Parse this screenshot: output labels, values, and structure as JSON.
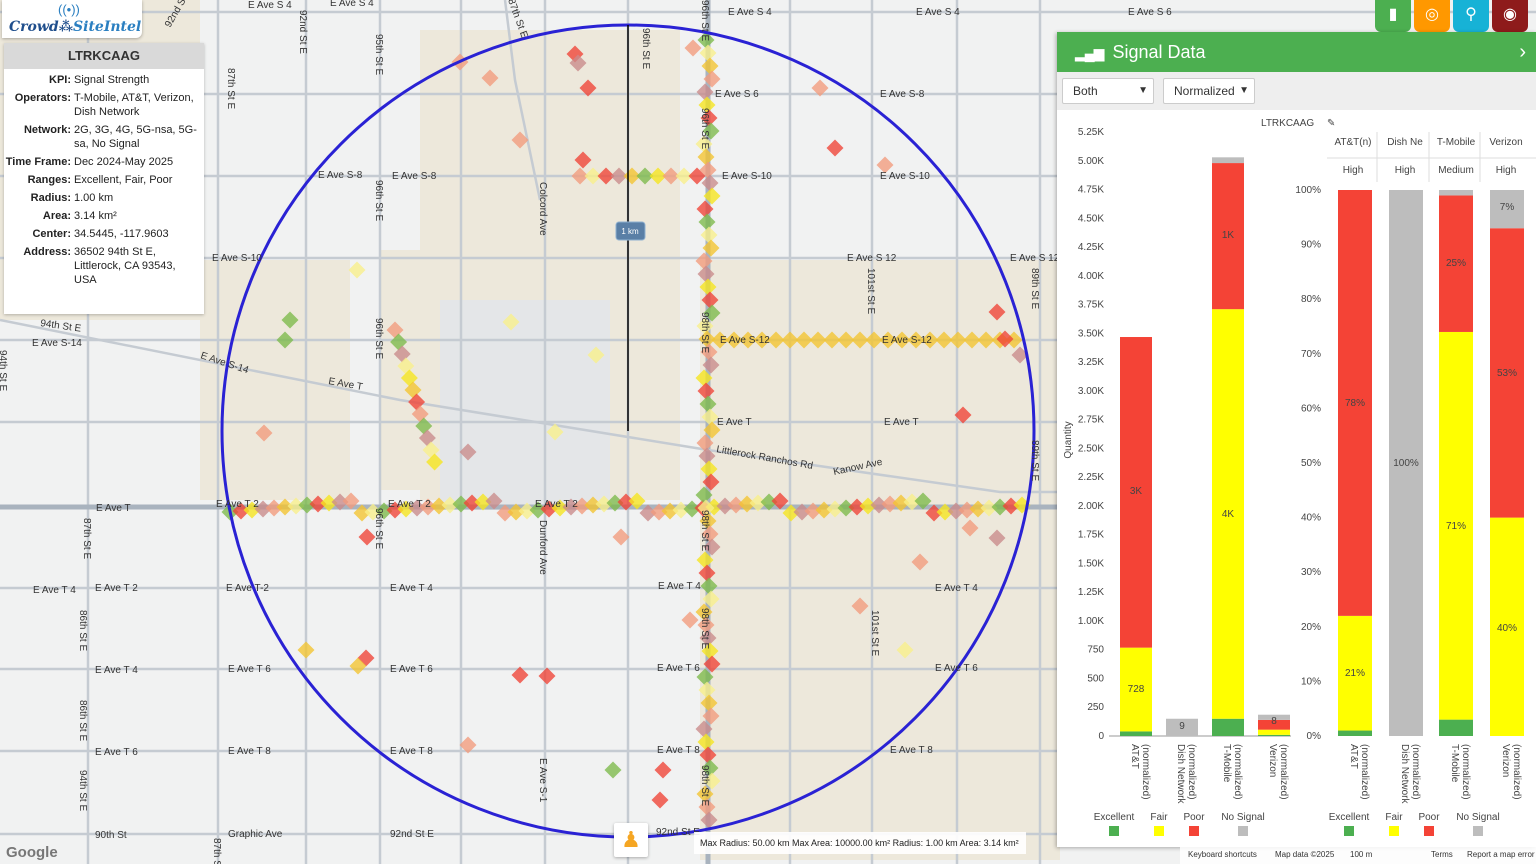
{
  "logo": {
    "text_a": "Crowd",
    "text_b": "SiteIntel",
    "icon": "signal-tower-icon"
  },
  "info": {
    "title": "LTRKCAAG",
    "rows": [
      {
        "k": "KPI:",
        "v": "Signal Strength"
      },
      {
        "k": "Operators:",
        "v": "T-Mobile, AT&T, Verizon, Dish Network"
      },
      {
        "k": "Network:",
        "v": "2G, 3G, 4G, 5G-nsa, 5G-sa, No Signal"
      },
      {
        "k": "Time Frame:",
        "v": "Dec 2024-May 2025"
      },
      {
        "k": "Ranges:",
        "v": "Excellent, Fair, Poor"
      },
      {
        "k": "Radius:",
        "v": "1.00 km"
      },
      {
        "k": "Area:",
        "v": "3.14 km²"
      },
      {
        "k": "Center:",
        "v": "34.5445, -117.9603"
      },
      {
        "k": "Address:",
        "v": "36502 94th St E, Littlerock, CA 93543, USA"
      }
    ]
  },
  "toolbar": {
    "buttons": [
      {
        "name": "chart-button",
        "icon": "bar-chart-icon",
        "glyph": "▮",
        "color": "#4caf50"
      },
      {
        "name": "target-button",
        "icon": "target-icon",
        "glyph": "◎",
        "color": "#ff9800"
      },
      {
        "name": "location-button",
        "icon": "location-pin-icon",
        "glyph": "⚲",
        "color": "#17b2d6"
      },
      {
        "name": "globe-button",
        "icon": "globe-icon",
        "glyph": "◉",
        "color": "#8e1b1b"
      }
    ]
  },
  "panel": {
    "title": "Signal Data",
    "select_operator": "Both",
    "select_mode": "Normalized",
    "chart_title": "LTRKCAAG",
    "tier_headers": [
      "AT&T(n)",
      "Dish Ne",
      "T-Mobile",
      "Verizon"
    ],
    "tier_values": [
      "High",
      "High",
      "Medium",
      "High"
    ],
    "tier_colors": [
      "#4caf50",
      "#4caf50",
      "#ff9800",
      "#4caf50"
    ]
  },
  "chart_data": [
    {
      "type": "bar",
      "stacked": true,
      "title": "LTRKCAAG",
      "ylabel": "Quantity",
      "ylim": [
        0,
        5250
      ],
      "yticks": [
        "0",
        "250",
        "500",
        "750",
        "1.00K",
        "1.25K",
        "1.50K",
        "1.75K",
        "2.00K",
        "2.25K",
        "2.50K",
        "2.75K",
        "3.00K",
        "3.25K",
        "3.50K",
        "3.75K",
        "4.00K",
        "4.25K",
        "4.50K",
        "4.75K",
        "5.00K",
        "5.25K"
      ],
      "categories": [
        "AT&T\n(normalized)",
        "Dish Network\n(normalized)",
        "T-Mobile\n(normalized)",
        "Verizon\n(normalized)"
      ],
      "series": [
        {
          "name": "Excellent",
          "color": "#4caf50",
          "values": [
            40,
            0,
            150,
            10
          ]
        },
        {
          "name": "Fair",
          "color": "#ffff00",
          "values": [
            728,
            0,
            3560,
            45
          ]
        },
        {
          "name": "Poor",
          "color": "#f44336",
          "values": [
            2700,
            0,
            1270,
            85
          ]
        },
        {
          "name": "No Signal",
          "color": "#bdbdbd",
          "values": [
            0,
            150,
            50,
            45
          ]
        }
      ],
      "data_labels": [
        "728",
        "3K",
        "9",
        "4K",
        "1K",
        "8"
      ],
      "legend": [
        "Excellent",
        "Fair",
        "Poor",
        "No Signal"
      ]
    },
    {
      "type": "bar",
      "stacked": true,
      "ylim": [
        0,
        100
      ],
      "yticks": [
        "0%",
        "10%",
        "20%",
        "30%",
        "40%",
        "50%",
        "60%",
        "70%",
        "80%",
        "90%",
        "100%"
      ],
      "categories": [
        "AT&T\n(normalized)",
        "Dish Network\n(normalized)",
        "T-Mobile\n(normalized)",
        "Verizon\n(normalized)"
      ],
      "series": [
        {
          "name": "Excellent",
          "color": "#4caf50",
          "values": [
            1,
            0,
            3,
            0
          ]
        },
        {
          "name": "Fair",
          "color": "#ffff00",
          "values": [
            21,
            0,
            71,
            40
          ]
        },
        {
          "name": "Poor",
          "color": "#f44336",
          "values": [
            78,
            0,
            25,
            53
          ]
        },
        {
          "name": "No Signal",
          "color": "#bdbdbd",
          "values": [
            0,
            100,
            1,
            7
          ]
        }
      ],
      "data_labels": [
        "21%",
        "78%",
        "100%",
        "71%",
        "25%",
        "40%",
        "53%",
        "7%"
      ],
      "legend": [
        "Excellent",
        "Fair",
        "Poor",
        "No Signal"
      ]
    }
  ],
  "map": {
    "scale_label": "1 km",
    "labels": [
      "E Ave S 4",
      "E Ave S 4",
      "E Ave S 4",
      "E Ave S 4",
      "E Ave S 6",
      "E Ave S 6",
      "E Ave S-8",
      "E Ave S-8",
      "E Ave S-8",
      "E Ave S-10",
      "E Ave S-10",
      "E Ave S-10",
      "E Ave S 12",
      "E Ave S 12",
      "E Ave S-12",
      "E Ave S-12",
      "E Ave S-14",
      "E Ave S-14",
      "E Ave T",
      "E Ave T",
      "E Ave T",
      "E Ave T",
      "E Ave T 2",
      "E Ave T 2",
      "E Ave T 2",
      "E Ave T 2",
      "E Ave T-2",
      "E Ave T 4",
      "E Ave T 4",
      "E Ave T 4",
      "E Ave T 4",
      "E Ave T 4",
      "E Ave T 6",
      "E Ave T 6",
      "E Ave T 6",
      "E Ave T 6",
      "E Ave T 6",
      "E Ave T 8",
      "E Ave T 8",
      "E Ave T 8",
      "E Ave T 8",
      "90th St",
      "Graphic Ave",
      "92nd St E",
      "92nd St E",
      "92nd St E",
      "92nd St E",
      "95th St E",
      "96th St E",
      "96th St E",
      "96th St E",
      "96th St E",
      "96th St E",
      "96th St E",
      "98th St E",
      "98th St E",
      "98th St E",
      "98th St E",
      "101st St E",
      "101st St E",
      "Littlerock Ranchos Rd",
      "Kanow Ave",
      "89th St E",
      "89th St E",
      "87th St E",
      "87th St E",
      "87th St E",
      "87th St E",
      "86th St E",
      "86th St E",
      "94th St E",
      "94th St E",
      "94th St E",
      "Colcord Ave",
      "Dunford Ave",
      "E Ave S-1"
    ],
    "scale_text": "Max Radius: 50.00 km Max Area: 10000.00 km² Radius: 1.00 km Area: 3.14 km²",
    "google": "Google",
    "attribution": [
      "Keyboard shortcuts",
      "Map data ©2025",
      "100 m",
      "Terms",
      "Report a map error"
    ]
  }
}
